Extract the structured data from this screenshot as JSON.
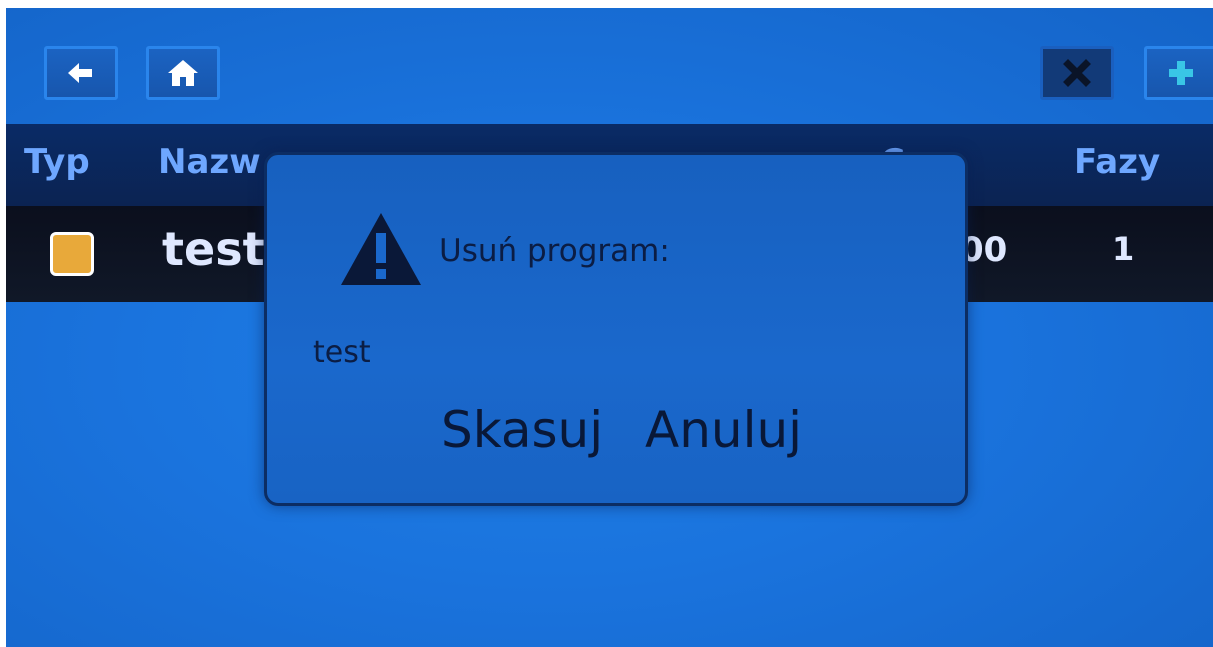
{
  "toolbar": {
    "back_icon": "arrow-left-icon",
    "home_icon": "home-icon",
    "delete_icon": "x-icon",
    "add_icon": "plus-icon"
  },
  "table": {
    "headers": {
      "type": "Typ",
      "name": "Nazw",
      "partial": "C",
      "phases": "Fazy"
    },
    "rows": [
      {
        "type_color": "#e8a93a",
        "name": "test",
        "partial_value": "00",
        "phases": "1"
      }
    ]
  },
  "dialog": {
    "icon": "warning-icon",
    "title": "Usuń program:",
    "item": "test",
    "delete_label": "Skasuj",
    "cancel_label": "Anuluj"
  },
  "colors": {
    "screen": "#1a73dd",
    "header_bg": "#0b2352",
    "header_text": "#6ea7ff",
    "row_bg": "#0e1424",
    "dialog_bg": "#1a68cc",
    "dialog_text": "#0b1d44"
  }
}
